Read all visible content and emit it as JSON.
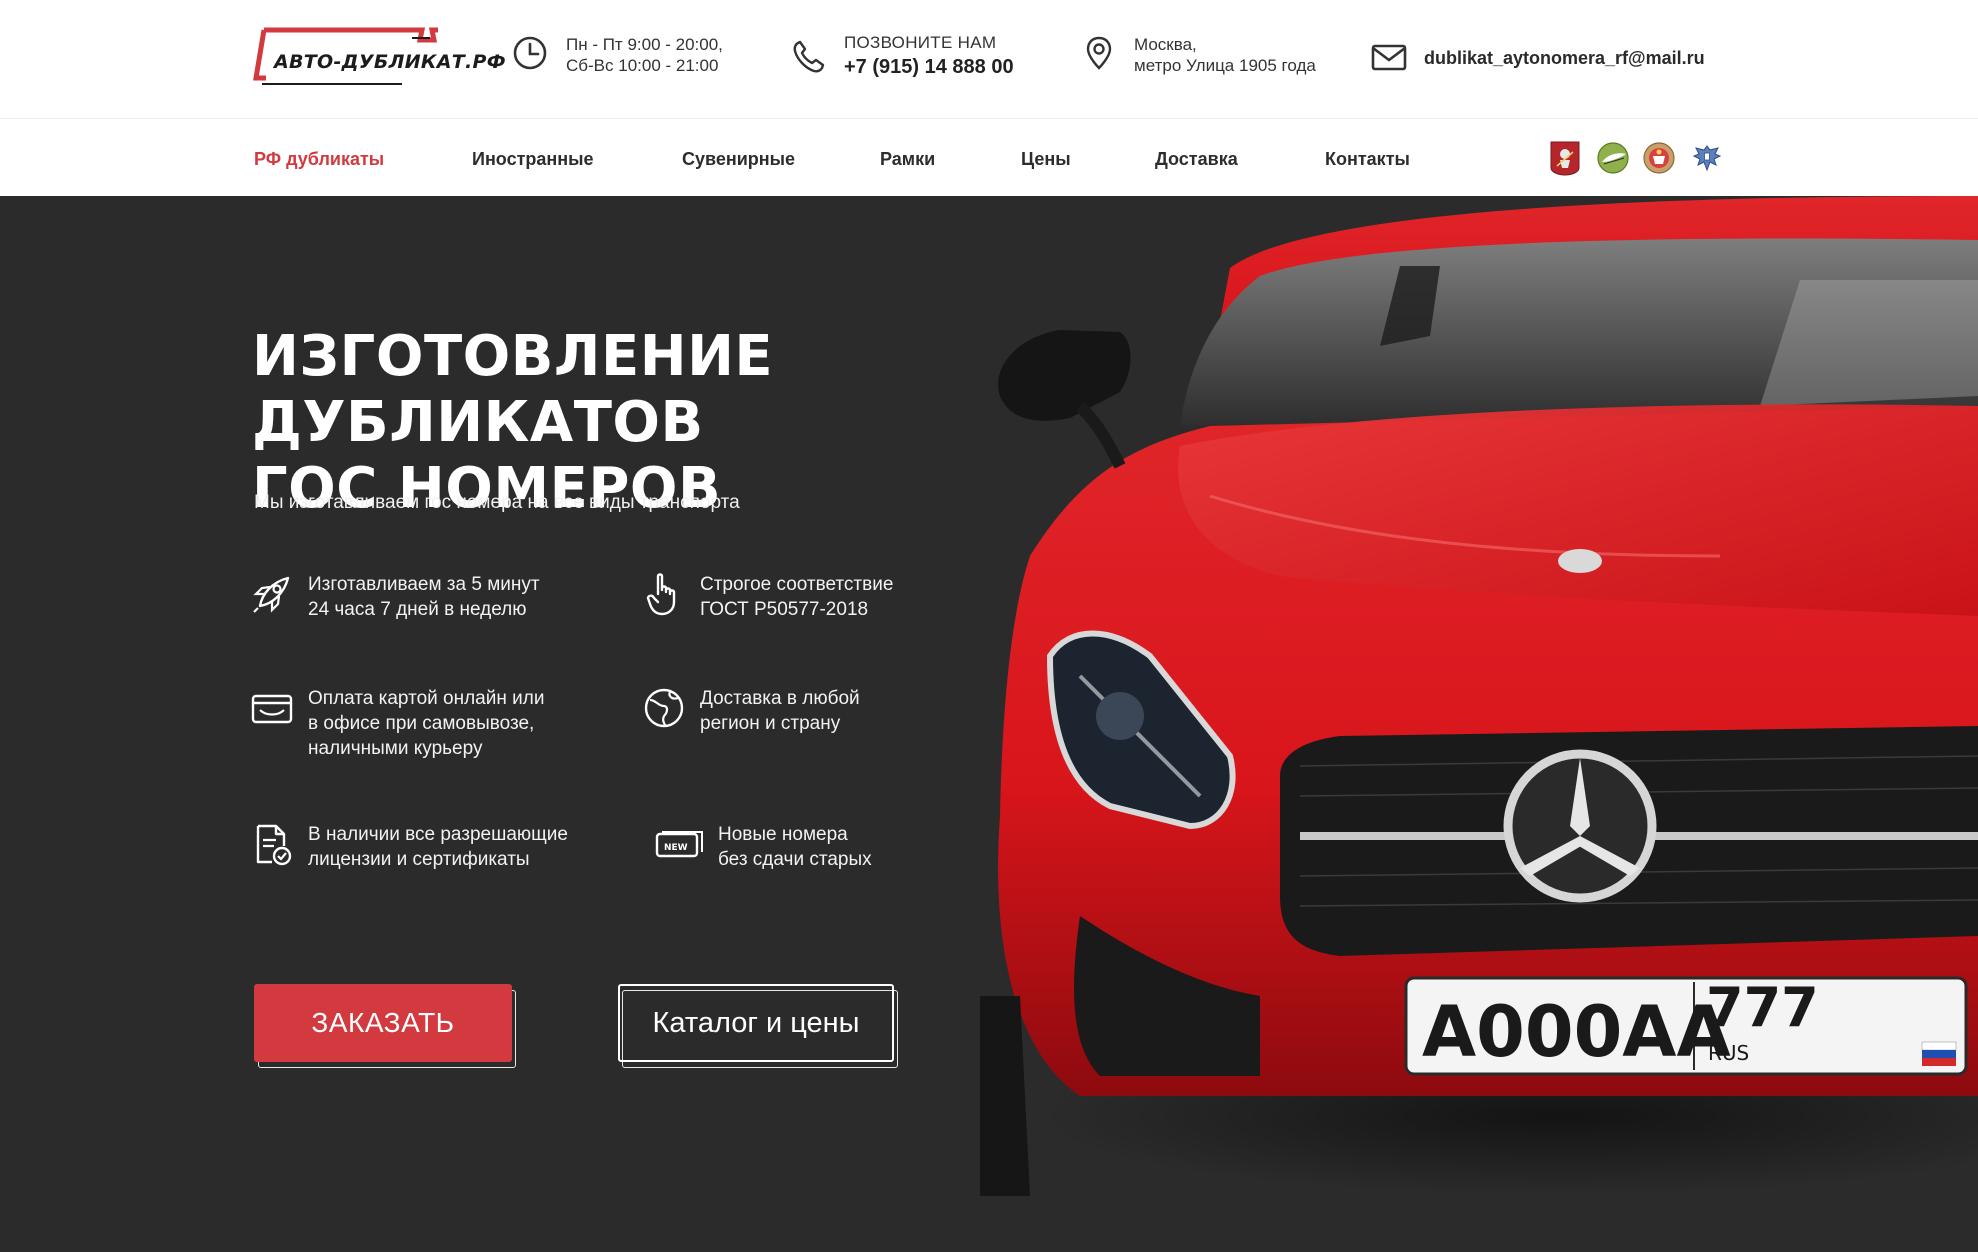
{
  "header": {
    "logo_text": "АВТО-ДУБЛИКАТ.РФ",
    "hours_line1": "Пн - Пт 9:00 - 20:00,",
    "hours_line2": "Сб-Вс 10:00 - 21:00",
    "call_label": "ПОЗВОНИТЕ НАМ",
    "phone": "+7 (915) 14 888 00",
    "address_line1": "Москва,",
    "address_line2": "метро Улица 1905 года",
    "email": "dublikat_aytonomera_rf@mail.ru",
    "icons": [
      "clock-icon",
      "phone-icon",
      "map-pin-icon",
      "mail-icon"
    ]
  },
  "nav": {
    "items": [
      {
        "label": "РФ дубликаты",
        "active": true
      },
      {
        "label": "Иностранные"
      },
      {
        "label": "Сувенирные"
      },
      {
        "label": "Рамки"
      },
      {
        "label": "Цены"
      },
      {
        "label": "Доставка"
      },
      {
        "label": "Контакты"
      }
    ],
    "emblems": [
      "moscow-emblem-icon",
      "green-emblem-icon",
      "gibdd-emblem-icon",
      "eagle-emblem-icon"
    ]
  },
  "hero": {
    "title_line1": "ИЗГОТОВЛЕНИЕ ДУБЛИКАТОВ",
    "title_line2": "ГОС НОМЕРОВ",
    "subtitle": "Мы изготавливаем гос номера на все виды транспорта",
    "features": [
      {
        "icon": "rocket-icon",
        "line1": "Изготавливаем за 5 минут",
        "line2": "24 часа 7 дней в неделю"
      },
      {
        "icon": "hand-pointer-icon",
        "line1": "Строгое соответствие",
        "line2": "ГОСТ Р50577-2018"
      },
      {
        "icon": "card-icon",
        "line1": "Оплата картой онлайн или",
        "line2": "в офисе при самовывозе,",
        "line3": "наличными курьеру"
      },
      {
        "icon": "globe-icon",
        "line1": "Доставка в любой",
        "line2": "регион и страну"
      },
      {
        "icon": "certificate-icon",
        "line1": "В наличии все разрешающие",
        "line2": "лицензии и сертификаты"
      },
      {
        "icon": "new-plate-icon",
        "badge": "NEW",
        "line1": "Новые номера",
        "line2": "без сдачи старых"
      }
    ],
    "order_button": "ЗАКАЗАТЬ",
    "catalog_button": "Каталог и цены",
    "plate": {
      "number": "А000АА",
      "region": "777",
      "country": "RUS"
    }
  },
  "colors": {
    "accent": "#d23a3f",
    "hero_bg": "#2b2b2c",
    "car_red": "#d8151b",
    "header_bg": "#ffffff"
  }
}
